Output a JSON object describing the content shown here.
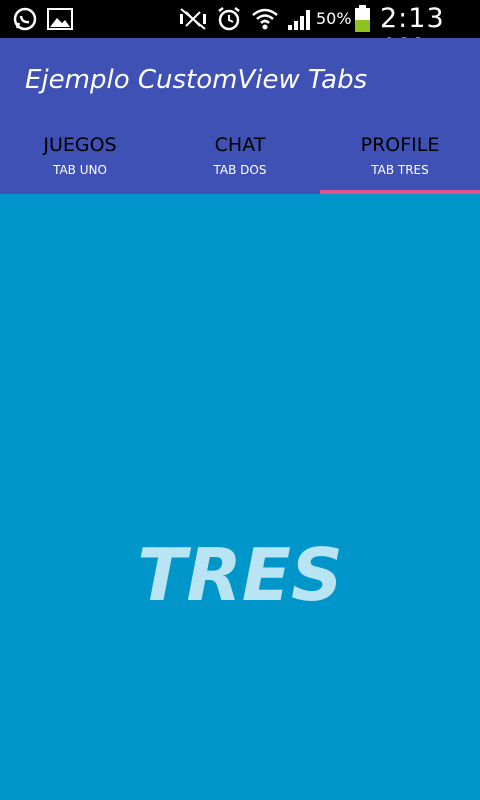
{
  "status_bar": {
    "icons": [
      "whatsapp-icon",
      "gallery-icon",
      "mute-icon",
      "alarm-icon",
      "wifi-icon",
      "signal-icon",
      "battery-icon"
    ],
    "battery_percent": "50%",
    "time": "2:13 AM",
    "battery_level": 0.5,
    "battery_color": "#8dc21f"
  },
  "app_bar": {
    "title": "Ejemplo CustomView Tabs",
    "background_color": "#3f51b5"
  },
  "tabs": [
    {
      "title": "JUEGOS",
      "subtitle": "TAB UNO",
      "selected": false
    },
    {
      "title": "CHAT",
      "subtitle": "TAB DOS",
      "selected": false
    },
    {
      "title": "PROFILE",
      "subtitle": "TAB TRES",
      "selected": true
    }
  ],
  "tab_indicator_color": "#e05690",
  "content": {
    "text": "TRES",
    "background_color": "#0096c9"
  }
}
